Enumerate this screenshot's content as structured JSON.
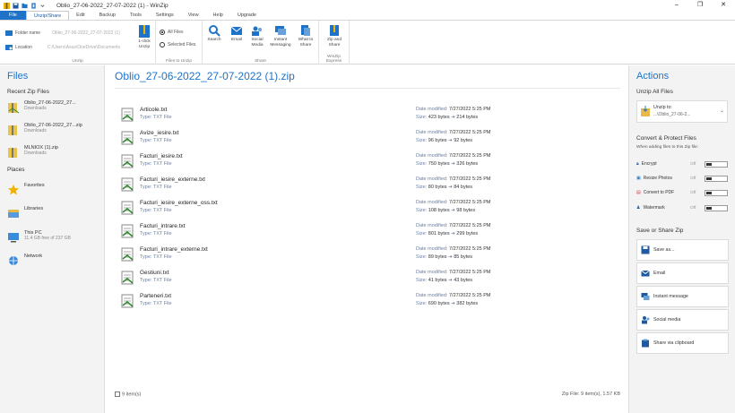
{
  "window": {
    "title": "Oblio_27-06-2022_27-07-2022 (1) - WinZip",
    "minimize": "–",
    "maximize": "❐",
    "close": "✕"
  },
  "menu": {
    "tabs": [
      "File",
      "Unzip/Share",
      "Edit",
      "Backup",
      "Tools",
      "Settings",
      "View",
      "Help",
      "Upgrade"
    ]
  },
  "ribbon": {
    "folder_label": "Folder name",
    "folder_value": "Oblio_27-06-2022_27-07-2022 (1)",
    "location_label": "Location",
    "location_value": "C:\\Users\\Asus\\OneDrive\\Documents",
    "unzip_button": "1-click\nUnzip",
    "all_files": "All Files",
    "selected_files": "Selected Files",
    "group_unzip": "Unzip",
    "group_files_to_unzip": "Files to Unzip",
    "search": "Search",
    "email": "Email",
    "social": "Social\nMedia",
    "instant": "Instant\nMessaging",
    "whats": "What to\nShare",
    "group_share": "Share",
    "zip_share": "Zip and\nShare",
    "group_express": "WinZip Express"
  },
  "files_panel": {
    "title": "Files",
    "recent_heading": "Recent Zip Files",
    "recent": [
      {
        "name": "Oblio_27-06-2022_27...",
        "loc": "Downloads"
      },
      {
        "name": "Oblio_27-06-2022_27...zip",
        "loc": "Downloads"
      },
      {
        "name": "MLNIOX (1).zip",
        "loc": "Downloads"
      }
    ],
    "places_heading": "Places",
    "places": [
      {
        "name": "Favorites",
        "sub": ""
      },
      {
        "name": "Libraries",
        "sub": ""
      },
      {
        "name": "This PC",
        "sub": "11.4 GB free of 237 GB"
      },
      {
        "name": "Network",
        "sub": ""
      }
    ]
  },
  "zip": {
    "title": "Oblio_27-06-2022_27-07-2022 (1).zip",
    "type_label": "Type: TXT File",
    "date_label": "Date modified: ",
    "size_label": "Size: ",
    "files": [
      {
        "name": "Articole.txt",
        "date": "7/27/2022 5:25 PM",
        "size": "423 bytes",
        "packed": "214 bytes"
      },
      {
        "name": "Avize_iesire.txt",
        "date": "7/27/2022 5:25 PM",
        "size": "96 bytes",
        "packed": "92 bytes"
      },
      {
        "name": "Facturi_iesire.txt",
        "date": "7/27/2022 5:25 PM",
        "size": "750 bytes",
        "packed": "326 bytes"
      },
      {
        "name": "Facturi_iesire_externe.txt",
        "date": "7/27/2022 5:25 PM",
        "size": "80 bytes",
        "packed": "84 bytes"
      },
      {
        "name": "Facturi_iesire_externe_oss.txt",
        "date": "7/27/2022 5:25 PM",
        "size": "108 bytes",
        "packed": "98 bytes"
      },
      {
        "name": "Facturi_intrare.txt",
        "date": "7/27/2022 5:25 PM",
        "size": "801 bytes",
        "packed": "299 bytes"
      },
      {
        "name": "Facturi_intrare_externe.txt",
        "date": "7/27/2022 5:25 PM",
        "size": "89 bytes",
        "packed": "85 bytes"
      },
      {
        "name": "Gestiuni.txt",
        "date": "7/27/2022 5:25 PM",
        "size": "41 bytes",
        "packed": "43 bytes"
      },
      {
        "name": "Parteneri.txt",
        "date": "7/27/2022 5:25 PM",
        "size": "690 bytes",
        "packed": "382 bytes"
      }
    ],
    "items_label": "9 item(s)",
    "summary": "Zip File: 9 item(s), 1.57 KB"
  },
  "actions": {
    "title": "Actions",
    "unzip_heading": "Unzip All Files",
    "unzip_to": "Unzip to:",
    "unzip_path": "...\\Oblio_27-06-2...",
    "convert_heading": "Convert & Protect Files",
    "convert_note": "When adding files to this Zip file:",
    "protect": [
      {
        "label": "Encrypt",
        "state": "Off"
      },
      {
        "label": "Resize Photos",
        "state": "Off"
      },
      {
        "label": "Convert to PDF",
        "state": "Off"
      },
      {
        "label": "Watermark",
        "state": "Off"
      }
    ],
    "share_heading": "Save or Share Zip",
    "share": [
      "Save as...",
      "Email",
      "Instant message",
      "Social media",
      "Share via clipboard"
    ]
  },
  "colors": {
    "accent": "#1e73c8",
    "panel": "#f3f3f3"
  }
}
